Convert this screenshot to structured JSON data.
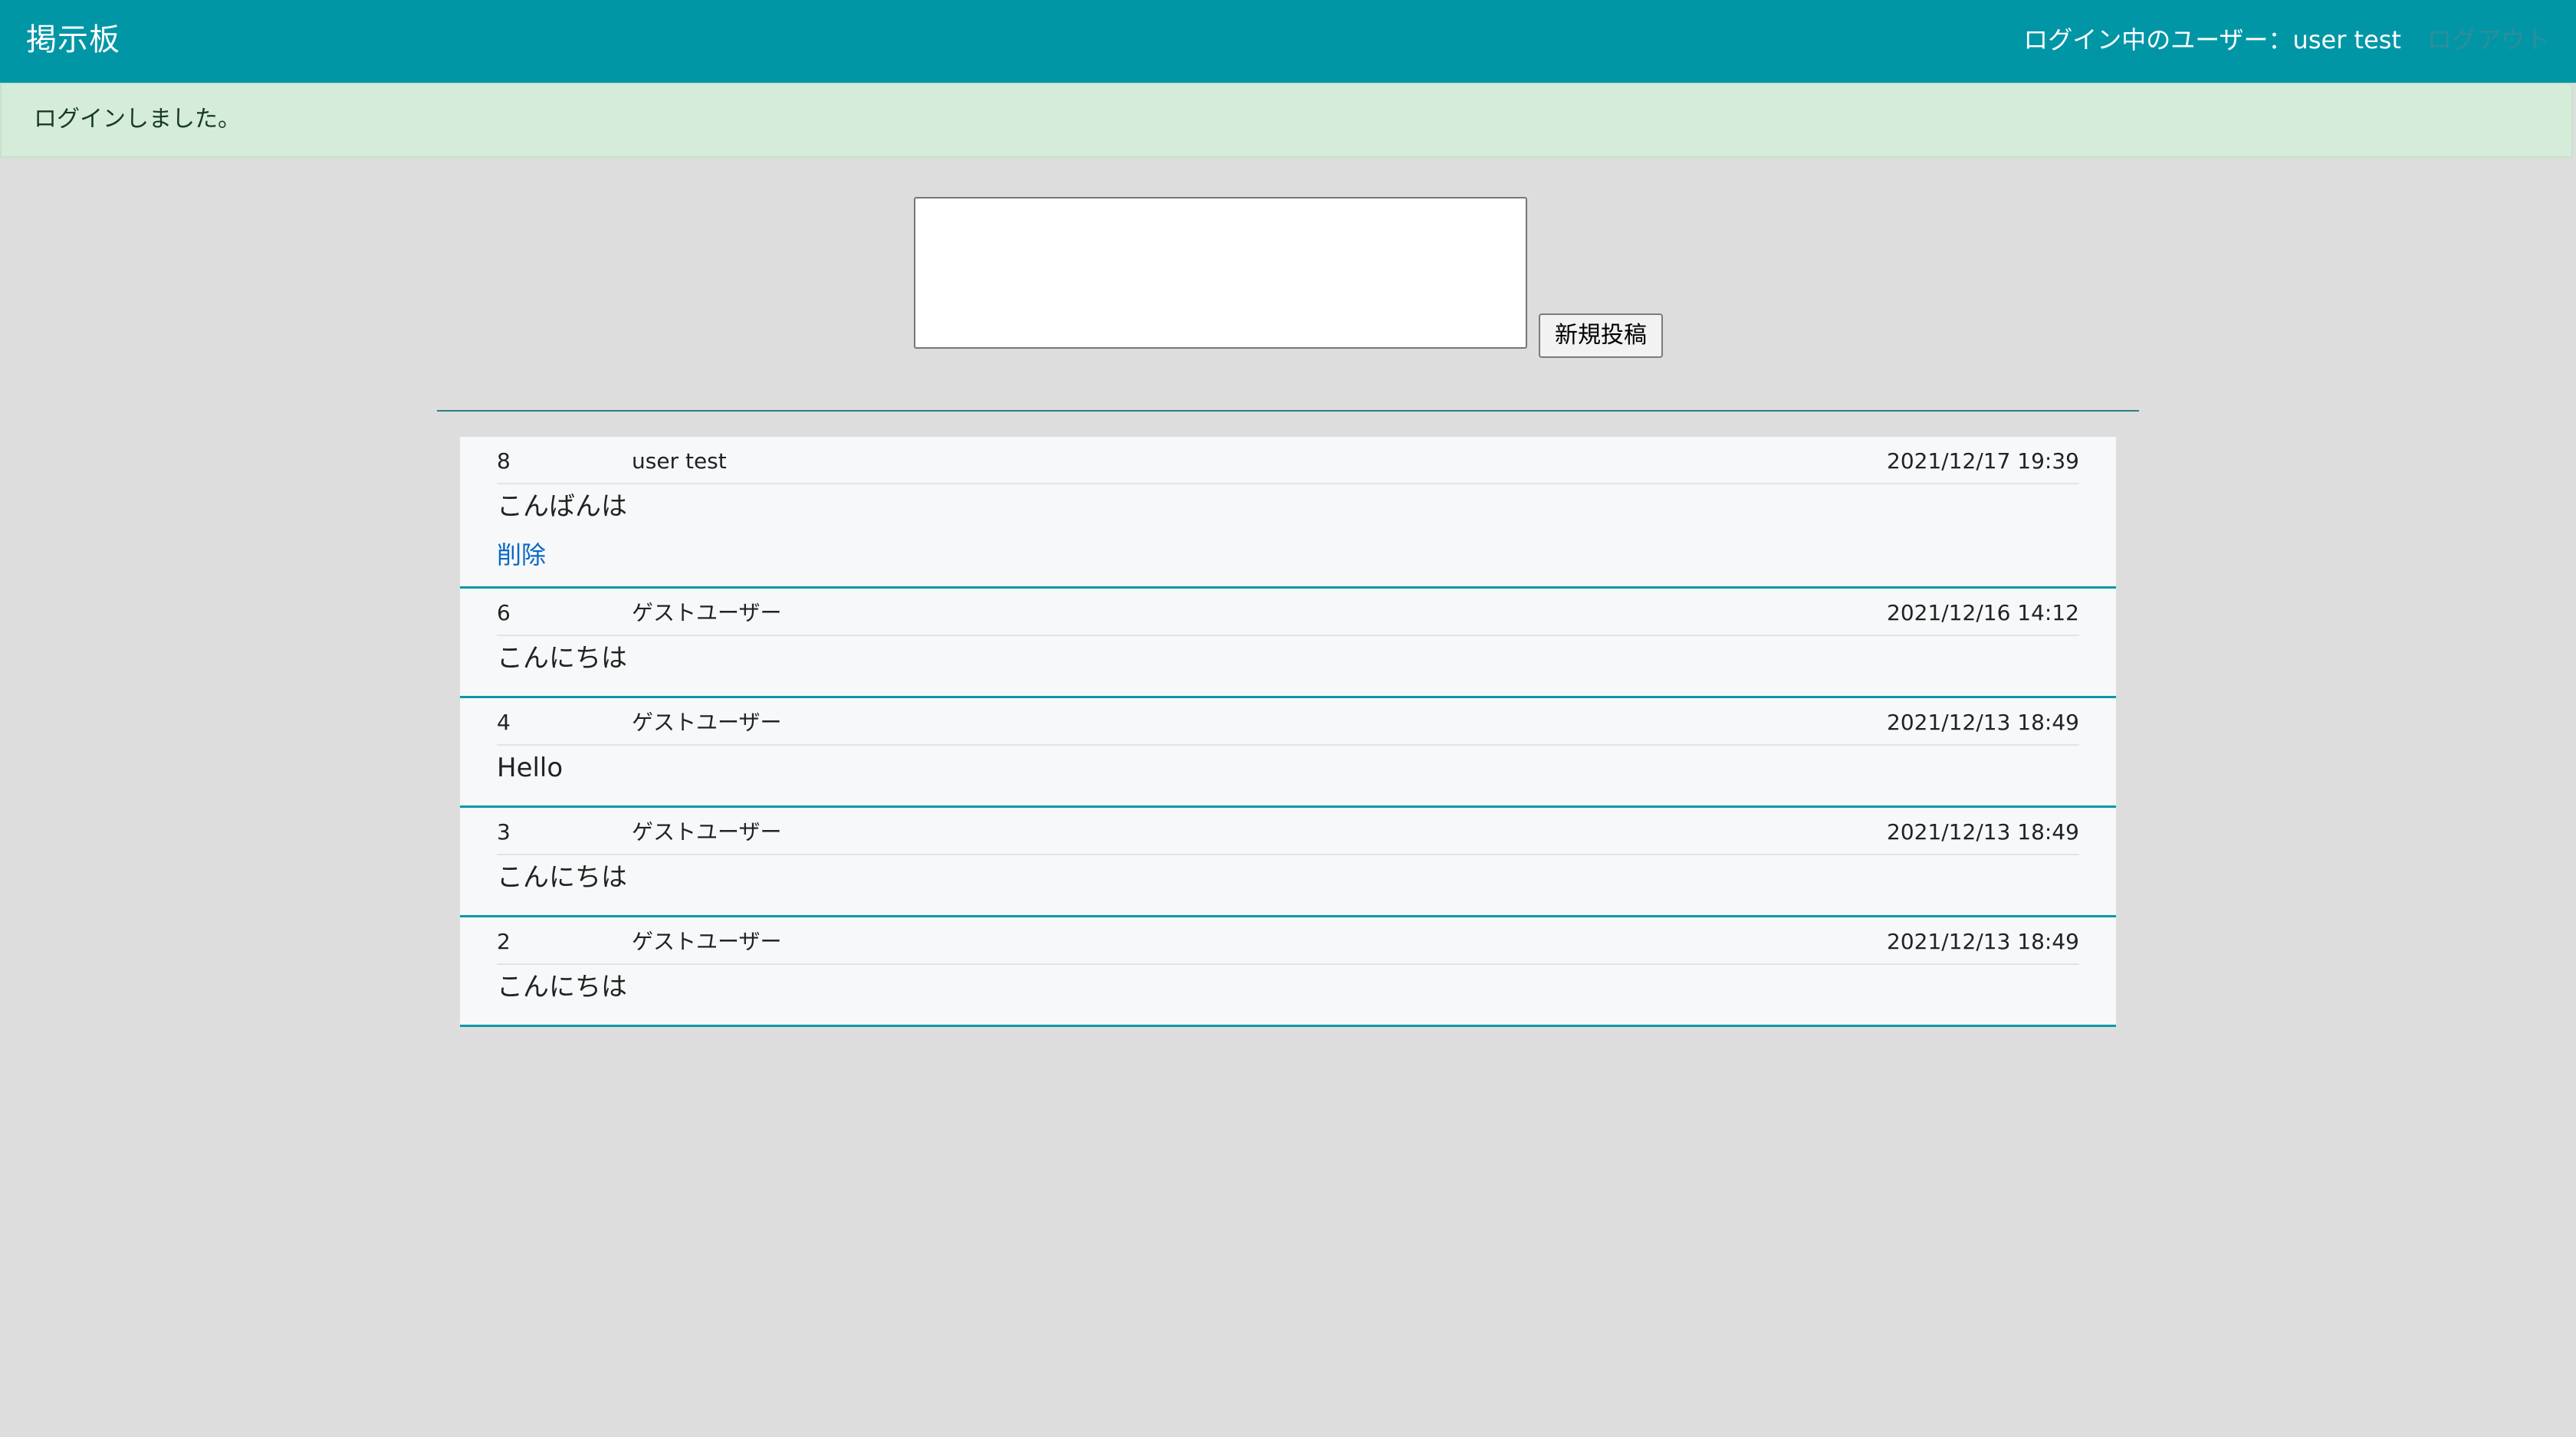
{
  "app": {
    "title": "掲示板"
  },
  "header": {
    "user_label": "ログイン中のユーザー：user test",
    "logout_label": "ログアウト"
  },
  "flash": {
    "message": "ログインしました。"
  },
  "composer": {
    "textarea_value": "",
    "submit_label": "新規投稿"
  },
  "colors": {
    "header_background": "#0196a6",
    "flash_background": "#d4ecd9",
    "page_background": "#dddddd",
    "post_background": "#f7f8f9",
    "post_border": "#0a98a6",
    "delete_link": "#0a68c5"
  },
  "posts": [
    {
      "id": "8",
      "author": "user test",
      "date": "2021/12/17 19:39",
      "content": "こんばんは",
      "delete_label": "削除"
    },
    {
      "id": "6",
      "author": "ゲストユーザー",
      "date": "2021/12/16 14:12",
      "content": "こんにちは"
    },
    {
      "id": "4",
      "author": "ゲストユーザー",
      "date": "2021/12/13 18:49",
      "content": "Hello"
    },
    {
      "id": "3",
      "author": "ゲストユーザー",
      "date": "2021/12/13 18:49",
      "content": "こんにちは"
    },
    {
      "id": "2",
      "author": "ゲストユーザー",
      "date": "2021/12/13 18:49",
      "content": "こんにちは"
    }
  ]
}
